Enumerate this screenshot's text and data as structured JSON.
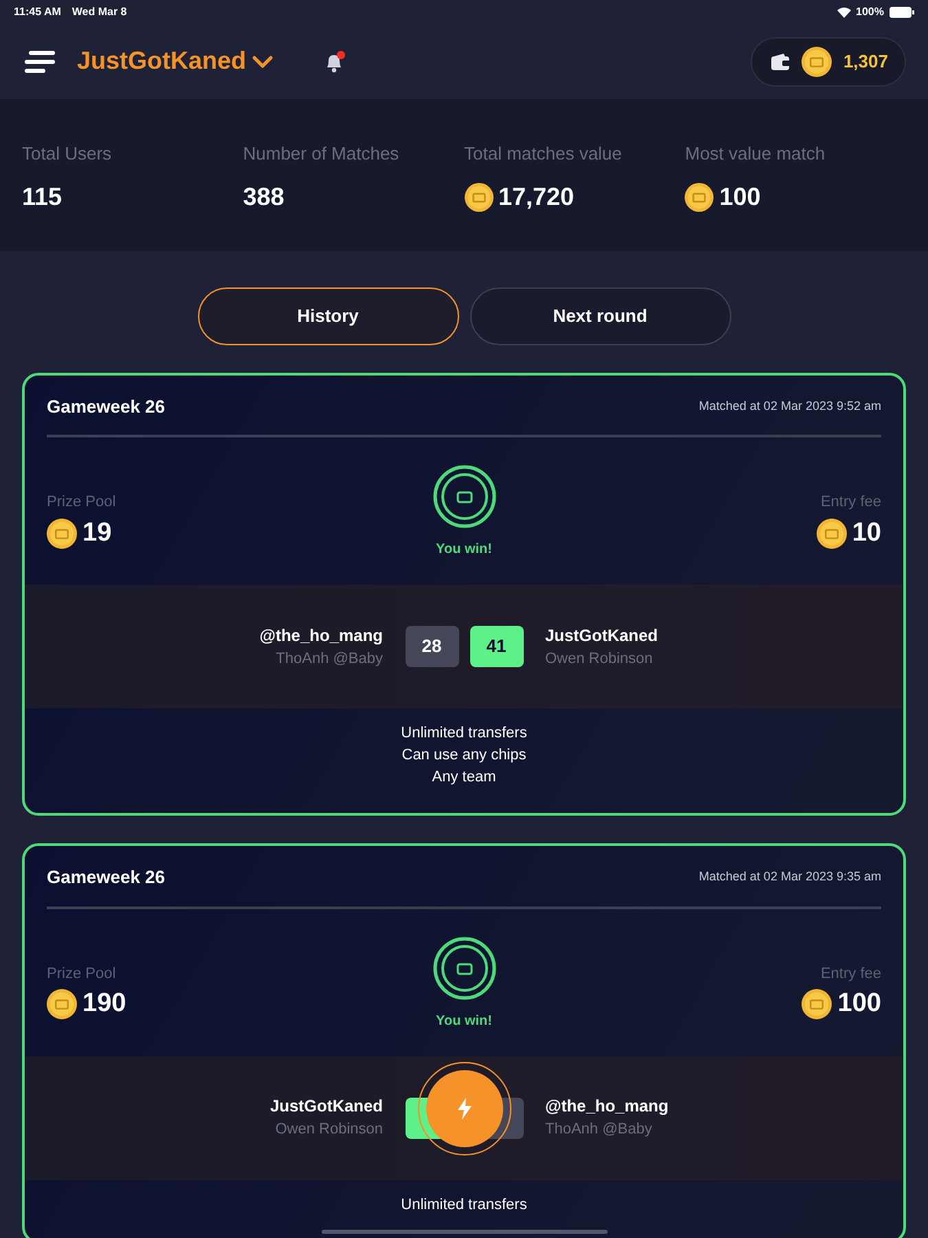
{
  "status_bar": {
    "time": "11:45 AM",
    "date": "Wed Mar 8",
    "battery": "100%"
  },
  "header": {
    "username": "JustGotKaned",
    "has_notification": true,
    "balance": "1,307"
  },
  "stats": [
    {
      "label": "Total Users",
      "value": "115",
      "coin": false
    },
    {
      "label": "Number of Matches",
      "value": "388",
      "coin": false
    },
    {
      "label": "Total matches value",
      "value": "17,720",
      "coin": true
    },
    {
      "label": "Most value match",
      "value": "100",
      "coin": true
    }
  ],
  "tabs": [
    {
      "label": "History",
      "selected": true
    },
    {
      "label": "Next round",
      "selected": false
    }
  ],
  "matches": [
    {
      "title": "Gameweek 26",
      "matched_at": "Matched at 02 Mar 2023 9:52 am",
      "prize_label": "Prize Pool",
      "prize": "19",
      "fee_label": "Entry fee",
      "fee": "10",
      "result": "You win!",
      "players": [
        {
          "handle": "@the_ho_mang",
          "name": "ThoAnh @Baby",
          "score": "28",
          "winner": false
        },
        {
          "handle": "JustGotKaned",
          "name": "Owen Robinson",
          "score": "41",
          "winner": true
        }
      ],
      "rules": [
        "Unlimited transfers",
        "Can use any chips",
        "Any team"
      ]
    },
    {
      "title": "Gameweek 26",
      "matched_at": "Matched at 02 Mar 2023 9:35 am",
      "prize_label": "Prize Pool",
      "prize": "190",
      "fee_label": "Entry fee",
      "fee": "100",
      "result": "You win!",
      "players": [
        {
          "handle": "JustGotKaned",
          "name": "Owen Robinson",
          "winner": true
        },
        {
          "handle": "@the_ho_mang",
          "name": "ThoAnh @Baby",
          "winner": false
        }
      ],
      "rules": [
        "Unlimited transfers"
      ]
    }
  ]
}
